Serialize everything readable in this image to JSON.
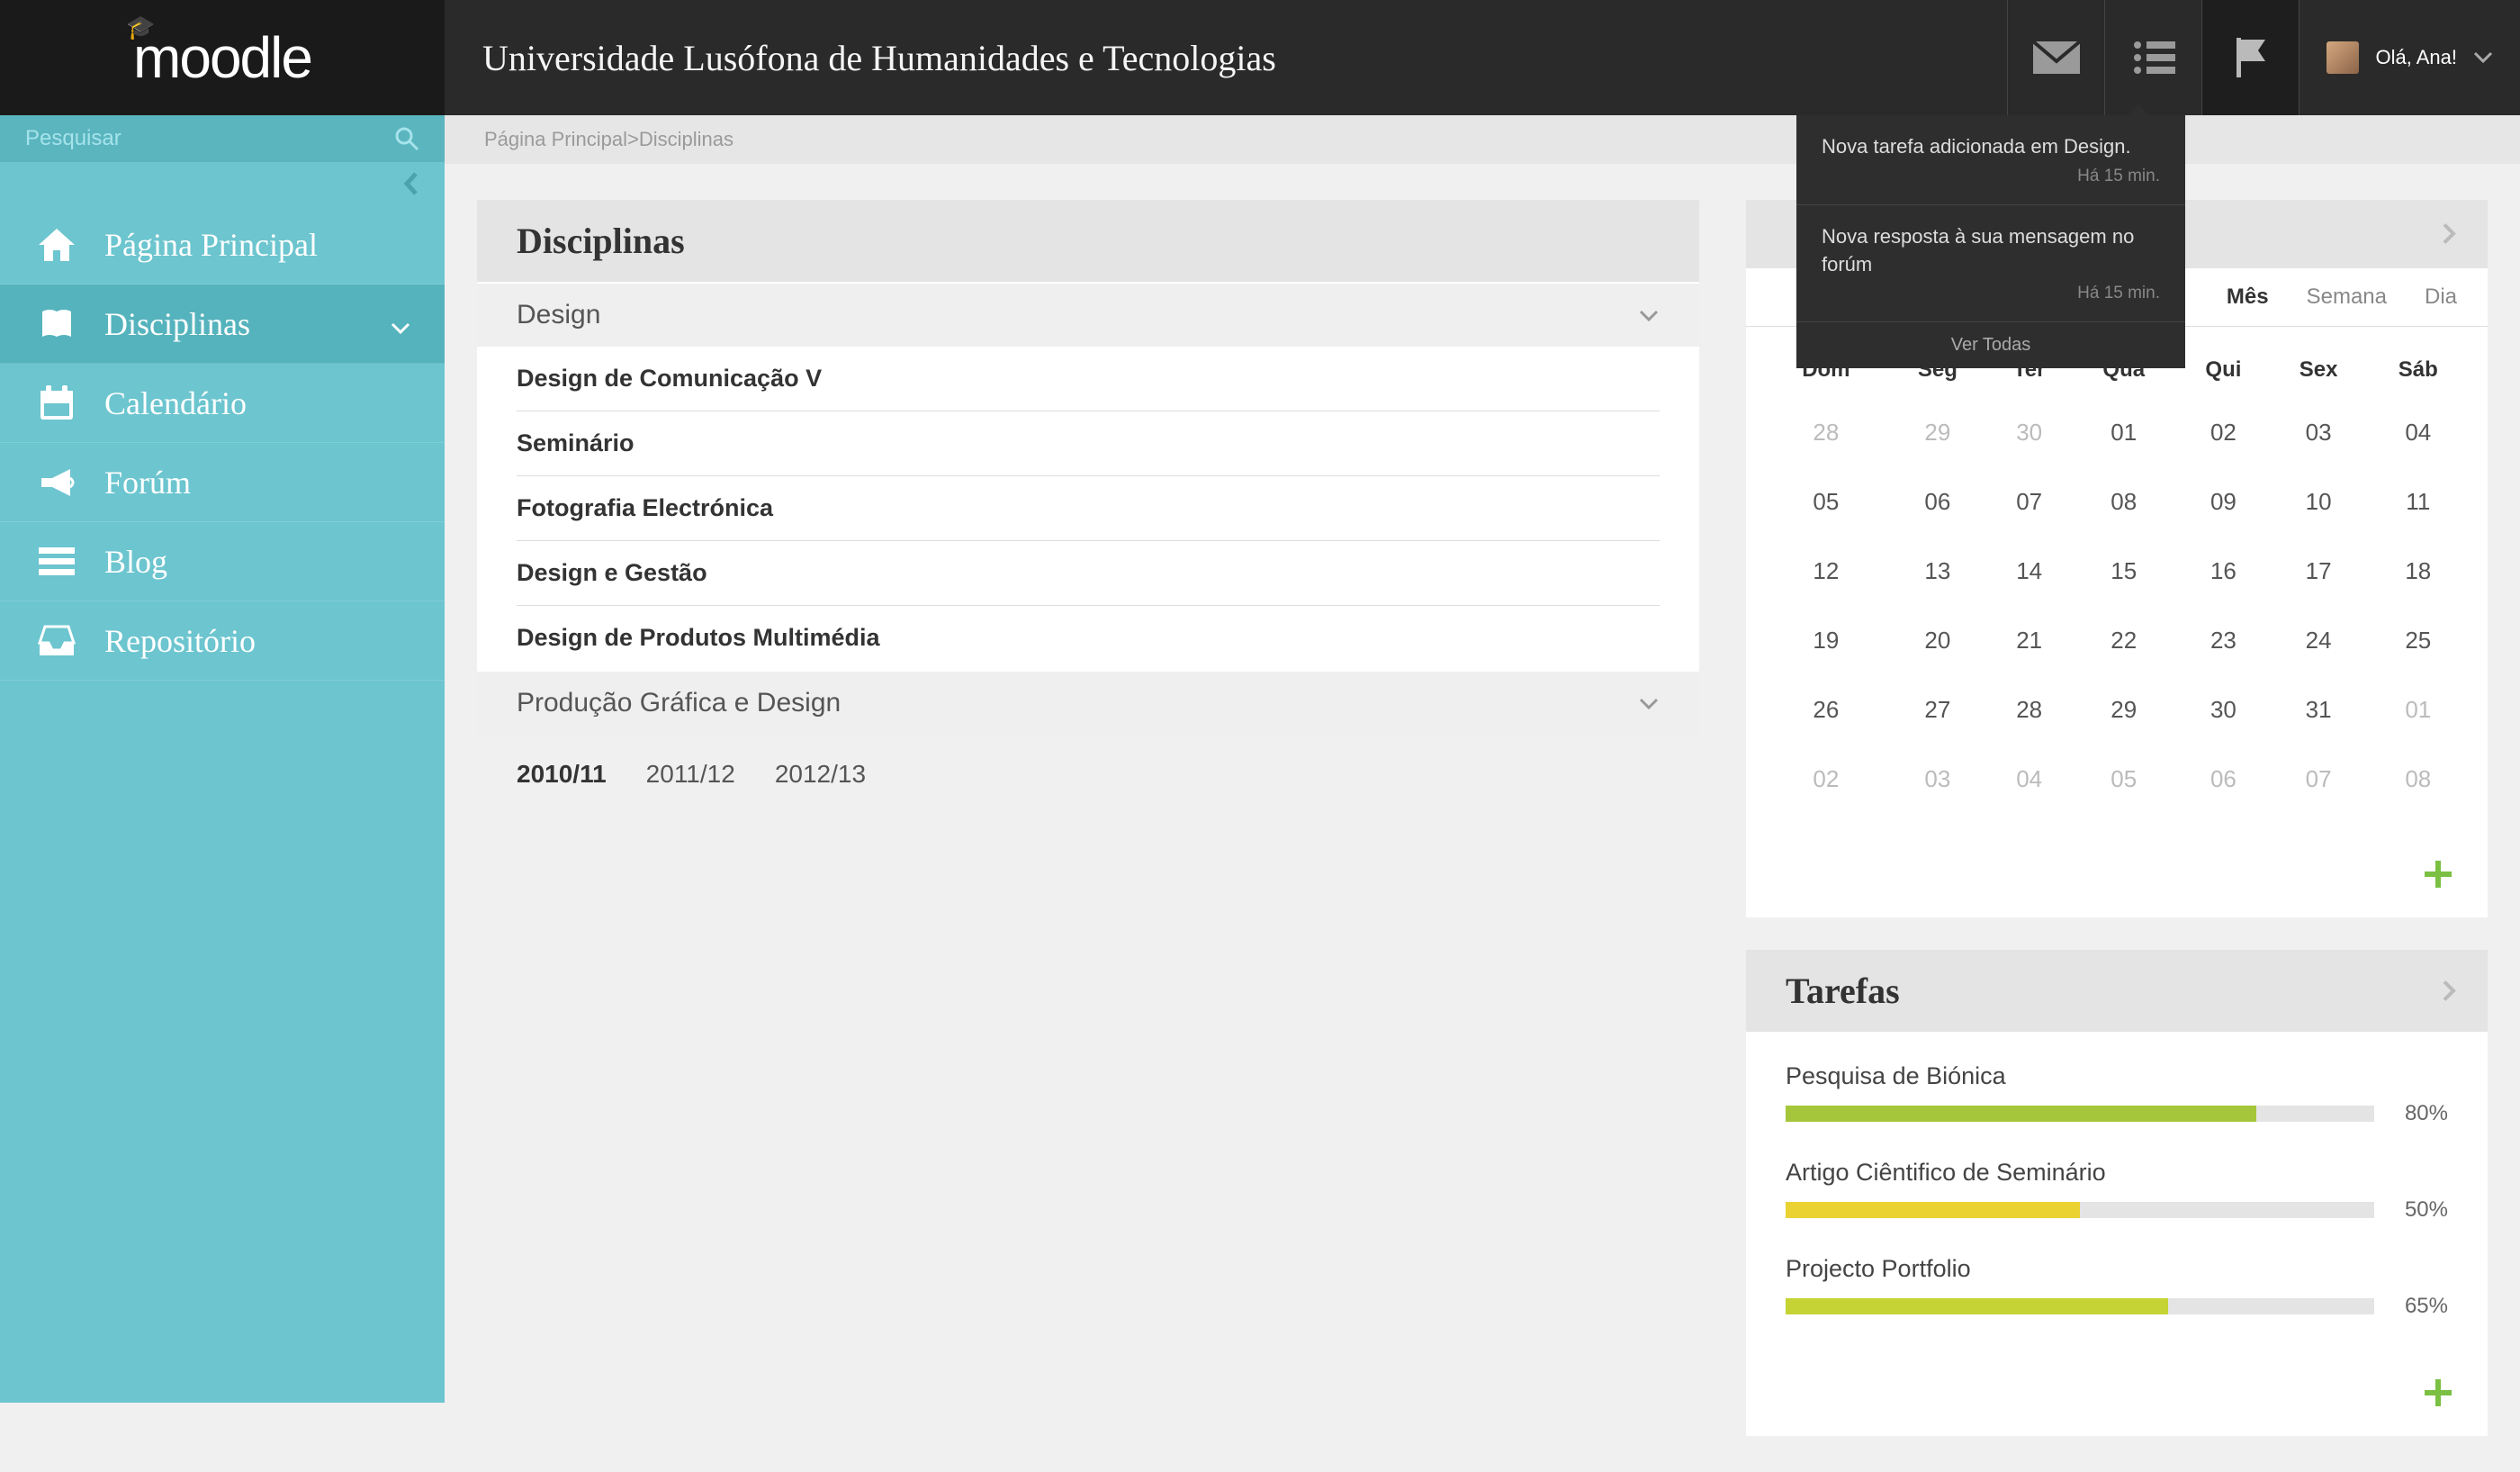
{
  "header": {
    "logo": "moodle",
    "university": "Universidade Lusófona de Humanidades e Tecnologias",
    "greeting": "Olá, Ana!"
  },
  "search": {
    "placeholder": "Pesquisar"
  },
  "sidebar": {
    "items": [
      {
        "label": "Página Principal",
        "icon": "home"
      },
      {
        "label": "Disciplinas",
        "icon": "book",
        "active": true,
        "expandable": true
      },
      {
        "label": "Calendário",
        "icon": "calendar"
      },
      {
        "label": "Forúm",
        "icon": "horn"
      },
      {
        "label": "Blog",
        "icon": "menu"
      },
      {
        "label": "Repositório",
        "icon": "inbox"
      }
    ]
  },
  "breadcrumb": {
    "root": "Página Principal",
    "sep": " > ",
    "current": "Disciplinas"
  },
  "main": {
    "title": "Disciplinas",
    "sections": [
      {
        "name": "Design",
        "expanded": true,
        "courses": [
          "Design de Comunicação V",
          "Seminário",
          "Fotografia Electrónica",
          "Design e Gestão",
          "Design de Produtos Multimédia"
        ]
      },
      {
        "name": "Produção Gráfica e Design",
        "expanded": false
      }
    ],
    "years": [
      "2010/11",
      "2011/12",
      "2012/13"
    ],
    "year_active": 0
  },
  "calendar": {
    "tabs": [
      "Mês",
      "Semana",
      "Dia"
    ],
    "tab_active": 0,
    "weekdays": [
      "Dom",
      "Seg",
      "Ter",
      "Qua",
      "Qui",
      "Sex",
      "Sáb"
    ],
    "weeks": [
      [
        {
          "d": "28",
          "dim": true
        },
        {
          "d": "29",
          "dim": true
        },
        {
          "d": "30",
          "dim": true
        },
        {
          "d": "01"
        },
        {
          "d": "02"
        },
        {
          "d": "03"
        },
        {
          "d": "04"
        }
      ],
      [
        {
          "d": "05"
        },
        {
          "d": "06"
        },
        {
          "d": "07"
        },
        {
          "d": "08"
        },
        {
          "d": "09"
        },
        {
          "d": "10"
        },
        {
          "d": "11"
        }
      ],
      [
        {
          "d": "12"
        },
        {
          "d": "13"
        },
        {
          "d": "14"
        },
        {
          "d": "15"
        },
        {
          "d": "16"
        },
        {
          "d": "17"
        },
        {
          "d": "18"
        }
      ],
      [
        {
          "d": "19"
        },
        {
          "d": "20"
        },
        {
          "d": "21"
        },
        {
          "d": "22"
        },
        {
          "d": "23"
        },
        {
          "d": "24"
        },
        {
          "d": "25"
        }
      ],
      [
        {
          "d": "26"
        },
        {
          "d": "27"
        },
        {
          "d": "28"
        },
        {
          "d": "29"
        },
        {
          "d": "30"
        },
        {
          "d": "31"
        },
        {
          "d": "01",
          "dim": true
        }
      ],
      [
        {
          "d": "02",
          "dim": true
        },
        {
          "d": "03",
          "dim": true
        },
        {
          "d": "04",
          "dim": true
        },
        {
          "d": "05",
          "dim": true
        },
        {
          "d": "06",
          "dim": true
        },
        {
          "d": "07",
          "dim": true
        },
        {
          "d": "08",
          "dim": true
        }
      ]
    ]
  },
  "tasks": {
    "title": "Tarefas",
    "items": [
      {
        "name": "Pesquisa de Biónica",
        "pct": 80,
        "color": "#a5c63b"
      },
      {
        "name": "Artigo Ciêntifico de Seminário",
        "pct": 50,
        "color": "#ead233"
      },
      {
        "name": "Projecto Portfolio",
        "pct": 65,
        "color": "#c5d334"
      }
    ]
  },
  "notifications": {
    "items": [
      {
        "text": "Nova tarefa adicionada em Design.",
        "time": "Há 15 min."
      },
      {
        "text": "Nova resposta à sua mensagem no forúm",
        "time": "Há 15 min."
      }
    ],
    "all": "Ver Todas"
  }
}
